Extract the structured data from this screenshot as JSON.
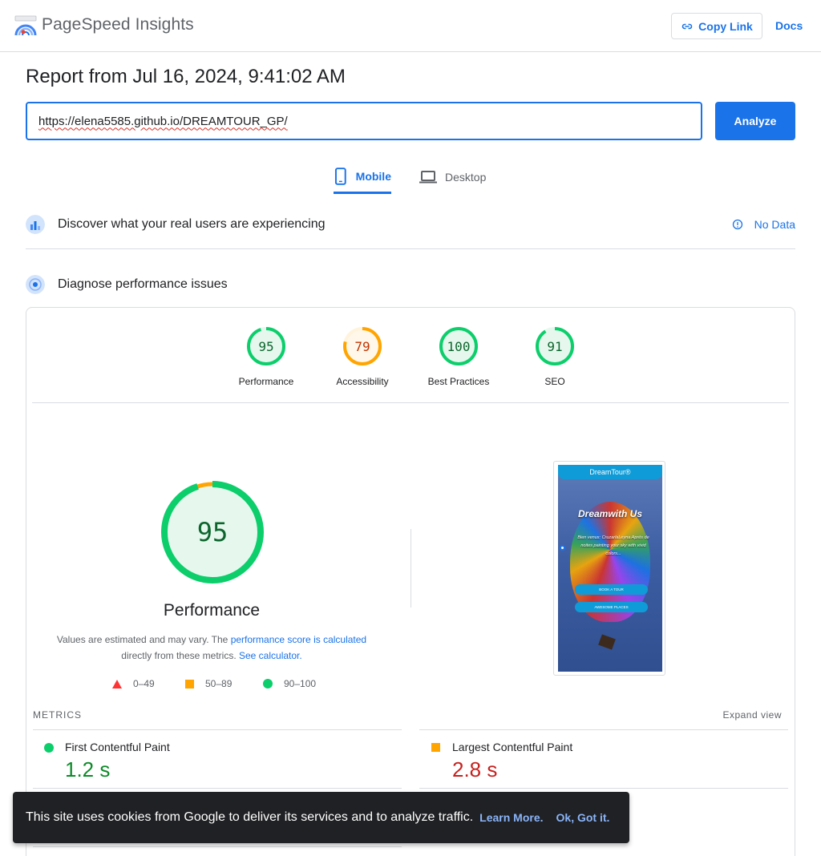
{
  "header": {
    "brand": "PageSpeed Insights",
    "copy_link": "Copy Link",
    "docs": "Docs"
  },
  "report": {
    "title": "Report from Jul 16, 2024, 9:41:02 AM",
    "url": "https://elena5585.github.io/DREAMTOUR_GP/",
    "analyze": "Analyze"
  },
  "tabs": [
    {
      "label": "Mobile",
      "selected": true
    },
    {
      "label": "Desktop",
      "selected": false
    }
  ],
  "field_data": {
    "title": "Discover what your real users are experiencing",
    "status": "No Data"
  },
  "diagnose": {
    "title": "Diagnose performance issues"
  },
  "scores": [
    {
      "label": "Performance",
      "value": 95,
      "color": "#0cce6b"
    },
    {
      "label": "Accessibility",
      "value": 79,
      "color": "#ffa400"
    },
    {
      "label": "Best Practices",
      "value": 100,
      "color": "#0cce6b"
    },
    {
      "label": "SEO",
      "value": 91,
      "color": "#0cce6b"
    }
  ],
  "performance": {
    "score": "95",
    "title": "Performance",
    "note_prefix": "Values are estimated and may vary. The",
    "note_link": "performance score is calculated",
    "note_mid": "directly from these metrics.",
    "note_link2": "See calculator.",
    "legend": [
      "0–49",
      "50–89",
      "90–100"
    ]
  },
  "preview": {
    "brand": "DreamTour®",
    "headline": "Dreamwith Us",
    "text": "Bien venus: CruzarlaLeyna Aprés de noites painting your sky with vivid colors...",
    "btn1": "BOOK A TOUR",
    "btn2": "AWESOME PLACES"
  },
  "metrics": {
    "label": "METRICS",
    "expand": "Expand view",
    "items": [
      {
        "name": "First Contentful Paint",
        "value": "1.2 s",
        "status": "good",
        "color": "#0d8a29"
      },
      {
        "name": "Largest Contentful Paint",
        "value": "2.8 s",
        "status": "average",
        "color": "#c5221f"
      }
    ]
  },
  "cookie": {
    "message": "This site uses cookies from Google to deliver its services and to analyze traffic.",
    "learn": "Learn More.",
    "ok": "Ok, Got it."
  }
}
